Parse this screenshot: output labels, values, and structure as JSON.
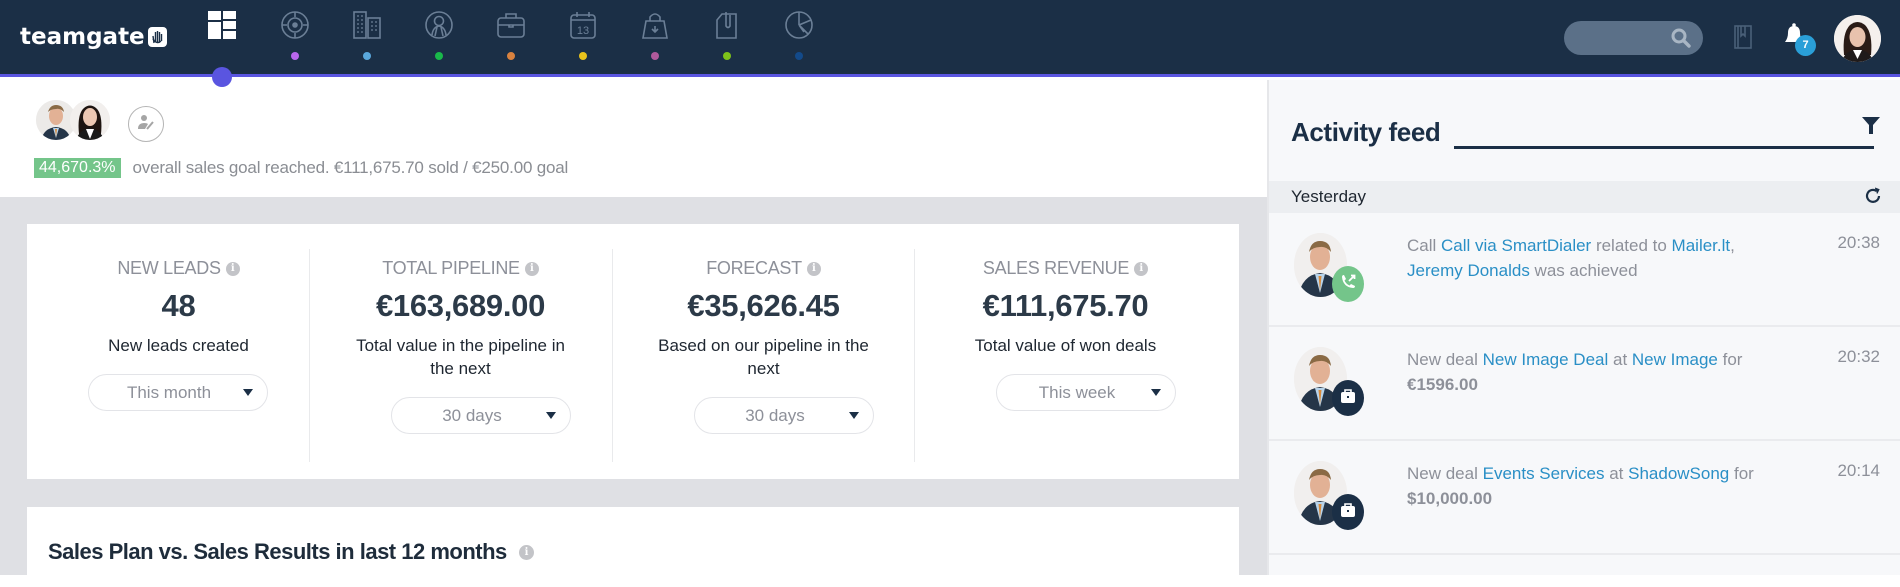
{
  "app": {
    "logo_text": "teamgate"
  },
  "nav": {
    "items": [
      {
        "name": "dashboard",
        "icon": "dashboard-grid-icon",
        "dot_color": null,
        "active": true
      },
      {
        "name": "leads",
        "icon": "target-icon",
        "dot_color": "#b967ed"
      },
      {
        "name": "companies",
        "icon": "buildings-icon",
        "dot_color": "#5aa8dc"
      },
      {
        "name": "people",
        "icon": "person-icon",
        "dot_color": "#19b84a"
      },
      {
        "name": "deals",
        "icon": "briefcase-icon",
        "dot_color": "#d9823f"
      },
      {
        "name": "calendar",
        "icon": "calendar-icon",
        "dot_color": "#e8c21c",
        "calendar_day": "13"
      },
      {
        "name": "sales",
        "icon": "shopping-bag-icon",
        "dot_color": "#b05a9c"
      },
      {
        "name": "documents",
        "icon": "document-clip-icon",
        "dot_color": "#7ec21a"
      },
      {
        "name": "reports",
        "icon": "pie-chart-icon",
        "dot_color": "#134a8a"
      }
    ],
    "accent_color": "#5a55e0"
  },
  "header_right": {
    "search_placeholder": "",
    "notifications_count": "7"
  },
  "goal": {
    "percent": "44,670.3%",
    "text": "overall sales goal reached.  €111,675.70 sold / €250.00 goal"
  },
  "stats": [
    {
      "title": "NEW LEADS",
      "value": "48",
      "description": "New leads created",
      "period": "This month"
    },
    {
      "title": "TOTAL PIPELINE",
      "value": "€163,689.00",
      "description": "Total value in the pipeline in the next",
      "period": "30 days"
    },
    {
      "title": "FORECAST",
      "value": "€35,626.45",
      "description": "Based on our pipeline in the next",
      "period": "30 days"
    },
    {
      "title": "SALES REVENUE",
      "value": "€111,675.70",
      "description": "Total value of won deals",
      "period": "This week"
    }
  ],
  "chart_section": {
    "title": "Sales Plan vs. Sales Results in last 12 months"
  },
  "feed": {
    "title": "Activity feed",
    "day_label": "Yesterday",
    "items": [
      {
        "type": "call",
        "time": "20:38",
        "parts": {
          "p1": "Call ",
          "l1": "Call via SmartDialer",
          "p2": " related to ",
          "l2": "Mailer.lt",
          "p3": ", ",
          "l3": "Jeremy Donalds",
          "p4": " was achieved"
        }
      },
      {
        "type": "deal",
        "time": "20:32",
        "parts": {
          "p1": "New deal ",
          "l1": "New Image Deal",
          "p2": " at ",
          "l2": "New Image",
          "p3": " for ",
          "amount": "€1596.00"
        }
      },
      {
        "type": "deal",
        "time": "20:14",
        "parts": {
          "p1": "New deal ",
          "l1": "Events Services",
          "p2": " at ",
          "l2": "ShadowSong",
          "p3": " for ",
          "amount": "$10,000.00"
        }
      }
    ]
  }
}
